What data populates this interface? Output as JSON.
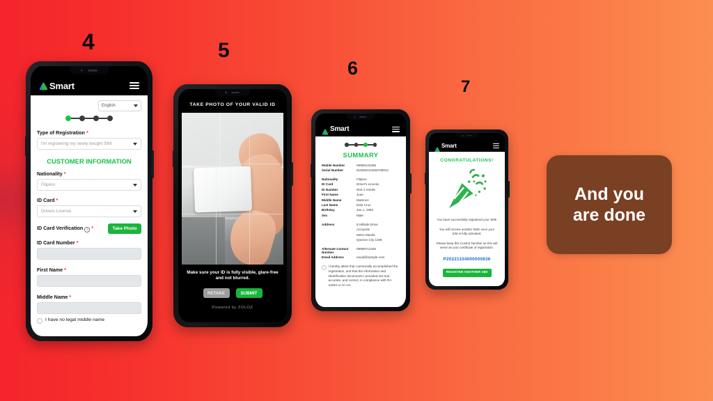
{
  "slide": {
    "callout_text": "And you are done",
    "callout_bg": "#7a4024",
    "background_from": "#f4252c",
    "background_to": "#fc8e50",
    "brand_green": "#19c24a"
  },
  "steps": [
    {
      "number": "4"
    },
    {
      "number": "5"
    },
    {
      "number": "6"
    },
    {
      "number": "7"
    }
  ],
  "brand": {
    "name": "Smart",
    "logo_icon": "smart-logo-icon",
    "menu_icon": "hamburger-menu-icon"
  },
  "phone4": {
    "language_value": "English",
    "stepper": {
      "total": 4,
      "active_index": 0
    },
    "fields": [
      {
        "label": "Type of Registration",
        "required": true,
        "value": "I'm registering my newly bought SIM",
        "type": "select"
      },
      {
        "label": "Nationality",
        "required": true,
        "value": "Filipino",
        "type": "select"
      },
      {
        "label": "ID Card",
        "required": true,
        "value": "Drivers License",
        "type": "select"
      }
    ],
    "section_title": "CUSTOMER INFORMATION",
    "verification": {
      "label": "ID Card Verification",
      "required": true,
      "info_icon": "info-circle-icon",
      "button_label": "Take Photo"
    },
    "empty_fields": [
      {
        "label": "ID Card Number",
        "required": true,
        "value": ""
      },
      {
        "label": "First Name",
        "required": true,
        "value": ""
      },
      {
        "label": "Middle Name",
        "required": true,
        "value": ""
      }
    ],
    "checkbox_label": "I have no legal middle name"
  },
  "phone5": {
    "title": "TAKE PHOTO OF YOUR VALID ID",
    "hint": "Make sure your ID is fully visible, glare-free and not blurred.",
    "retake_label": "RETAKE",
    "submit_label": "SUBMIT",
    "powered_by": "Powered by ZOLOZ"
  },
  "phone6": {
    "stepper": {
      "total": 4,
      "active_index": 2
    },
    "title": "SUMMARY",
    "group1": [
      {
        "key": "Mobile Number",
        "value": "09989123456"
      },
      {
        "key": "Serial Number",
        "value": "515050123456789012"
      }
    ],
    "group2": [
      {
        "key": "Nationality",
        "value": "Filipino"
      },
      {
        "key": "ID Card",
        "value": "Driver's License"
      },
      {
        "key": "ID Number",
        "value": "N04-1-23435"
      },
      {
        "key": "First Name",
        "value": "Juan"
      },
      {
        "key": "Middle Name",
        "value": "Martinez"
      },
      {
        "key": "Last Name",
        "value": "Dela Cruz"
      },
      {
        "key": "Birthday",
        "value": "Jan 1, 1990"
      },
      {
        "key": "Sex",
        "value": "Male"
      }
    ],
    "address": {
      "key": "Address",
      "lines": [
        "8 Hillside Drive",
        "Acropolis",
        "Metro Manila",
        "Quezon City 1198"
      ]
    },
    "group3": [
      {
        "key": "Alternate Contact Number",
        "value": "09989712345"
      },
      {
        "key": "Email Address",
        "value": "email@sample.com"
      }
    ],
    "attestation": "I hereby attest that I personally accomplished the registration, and that the information and identification documents I provided are true, accurate, and correct, in compliance with RA 11934 or An Act"
  },
  "phone7": {
    "title": "CONGRATULATIONS!",
    "confetti_icon": "party-popper-icon",
    "paragraphs": [
      "You have successfully registered your SIM!",
      "You will receive another SMS once your SIM is fully activated.",
      "Please keep this Control Number as this will serve as your certificate of registration."
    ],
    "control_number": "P20221104000000636",
    "button_label": "REGISTER ANOTHER SIM"
  }
}
